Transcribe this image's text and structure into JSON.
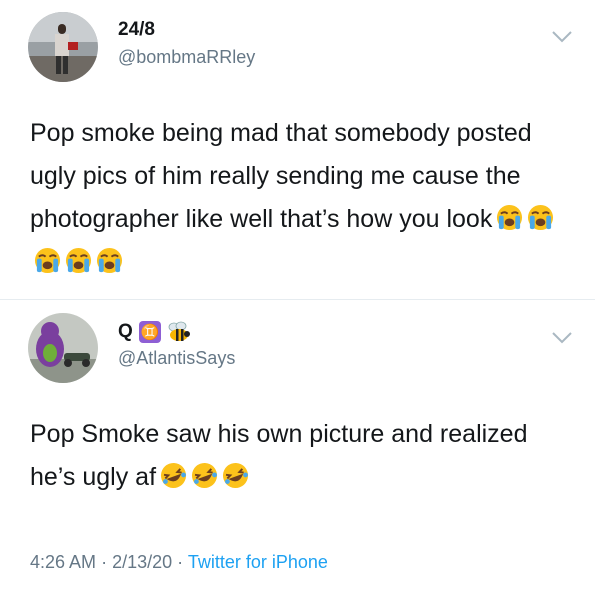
{
  "tweets": [
    {
      "display_name": "24/8",
      "handle": "@bombmaRRley",
      "text": "Pop smoke being mad that somebody posted ugly pics of him really sending me cause the photographer like well that’s how you look",
      "emoji": [
        "crying-face",
        "crying-face",
        "crying-face",
        "crying-face",
        "crying-face"
      ]
    },
    {
      "display_name": "Q",
      "name_icons": [
        "gemini-symbol-icon",
        "bee-icon"
      ],
      "gemini_glyph": "♊",
      "handle": "@AtlantisSays",
      "text": "Pop Smoke saw his own picture and realized he’s ugly af",
      "emoji": [
        "laughing-face",
        "laughing-face",
        "laughing-face"
      ],
      "time": "4:26 AM",
      "date": "2/13/20",
      "source": "Twitter for iPhone",
      "separator": "·"
    }
  ],
  "colors": {
    "text": "#14171a",
    "muted": "#657786",
    "link": "#1da1f2",
    "divider": "#e6ecf0"
  }
}
